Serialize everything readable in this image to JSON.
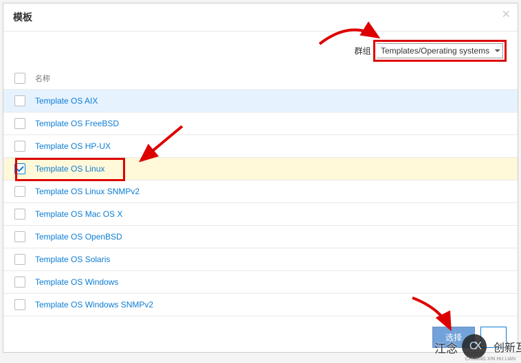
{
  "modal": {
    "title": "模板",
    "close": "✕"
  },
  "filter": {
    "label": "群组",
    "selected": "Templates/Operating systems"
  },
  "table": {
    "header_name": "名称",
    "rows": [
      {
        "label": "Template OS AIX",
        "checked": false,
        "highlight": "blue"
      },
      {
        "label": "Template OS FreeBSD",
        "checked": false,
        "highlight": ""
      },
      {
        "label": "Template OS HP-UX",
        "checked": false,
        "highlight": ""
      },
      {
        "label": "Template OS Linux",
        "checked": true,
        "highlight": "yellow"
      },
      {
        "label": "Template OS Linux SNMPv2",
        "checked": false,
        "highlight": ""
      },
      {
        "label": "Template OS Mac OS X",
        "checked": false,
        "highlight": ""
      },
      {
        "label": "Template OS OpenBSD",
        "checked": false,
        "highlight": ""
      },
      {
        "label": "Template OS Solaris",
        "checked": false,
        "highlight": ""
      },
      {
        "label": "Template OS Windows",
        "checked": false,
        "highlight": ""
      },
      {
        "label": "Template OS Windows SNMPv2",
        "checked": false,
        "highlight": ""
      }
    ]
  },
  "footer": {
    "primary": "选择",
    "secondary": " "
  },
  "watermark": {
    "text1": "江念",
    "text2": "创新互",
    "badge": "CX",
    "sub": "CHUANG XIN HU LIAN"
  }
}
